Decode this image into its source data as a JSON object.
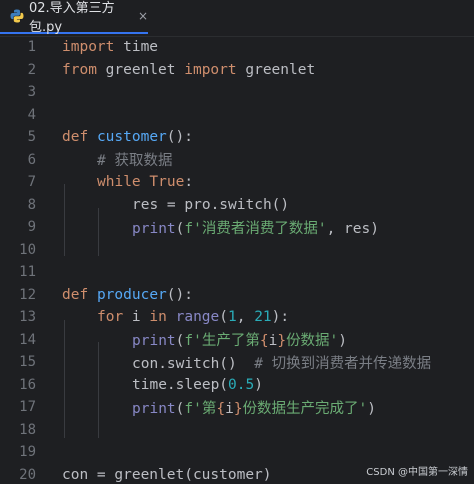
{
  "tab": {
    "filename": "02.导入第三方包.py",
    "close_symbol": "×",
    "icon": "python-file-icon"
  },
  "line_numbers": [
    "1",
    "2",
    "3",
    "4",
    "5",
    "6",
    "7",
    "8",
    "9",
    "10",
    "11",
    "12",
    "13",
    "14",
    "15",
    "16",
    "17",
    "18",
    "19",
    "20"
  ],
  "code": {
    "l1_kw": "import",
    "l1_rest": " time",
    "l2_kw1": "from",
    "l2_mid": " greenlet ",
    "l2_kw2": "import",
    "l2_rest": " greenlet",
    "l5_kw": "def",
    "l5_fn": "customer",
    "l5_rest": "():",
    "l6_cmt": "# 获取数据",
    "l7_kw": "while",
    "l7_true": "True",
    "l7_rest": ":",
    "l8_text": "res = pro.switch()",
    "l9_bi": "print",
    "l9_open": "(",
    "l9_str": "f'消费者消费了数据'",
    "l9_rest": ", res)",
    "l12_kw": "def",
    "l12_fn": "producer",
    "l12_rest": "():",
    "l13_kw1": "for",
    "l13_var": " i ",
    "l13_kw2": "in",
    "l13_sp": " ",
    "l13_bi": "range",
    "l13_open": "(",
    "l13_n1": "1",
    "l13_comma": ", ",
    "l13_n2": "21",
    "l13_close": "):",
    "l14_bi": "print",
    "l14_open": "(",
    "l14_s1": "f'生产了第",
    "l14_b1": "{",
    "l14_var": "i",
    "l14_b2": "}",
    "l14_s2": "份数据'",
    "l14_close": ")",
    "l15_text": "con.switch()",
    "l15_cmt": "  # 切换到消费者并传递数据",
    "l16_text": "time.sleep(",
    "l16_num": "0.5",
    "l16_close": ")",
    "l17_bi": "print",
    "l17_open": "(",
    "l17_s1": "f'第",
    "l17_b1": "{",
    "l17_var": "i",
    "l17_b2": "}",
    "l17_s2": "份数据生产完成了'",
    "l17_close": ")",
    "l20_text": "con = greenlet(customer)"
  },
  "watermark": "CSDN @中国第一深情",
  "colors": {
    "background": "#1e1f22",
    "keyword": "#cf8e6d",
    "function": "#56a8f5",
    "builtin": "#8888c6",
    "string": "#6aab73",
    "number": "#2aacb8",
    "comment": "#7a7e85",
    "text": "#bcbec4",
    "tab_underline": "#3574f0"
  }
}
